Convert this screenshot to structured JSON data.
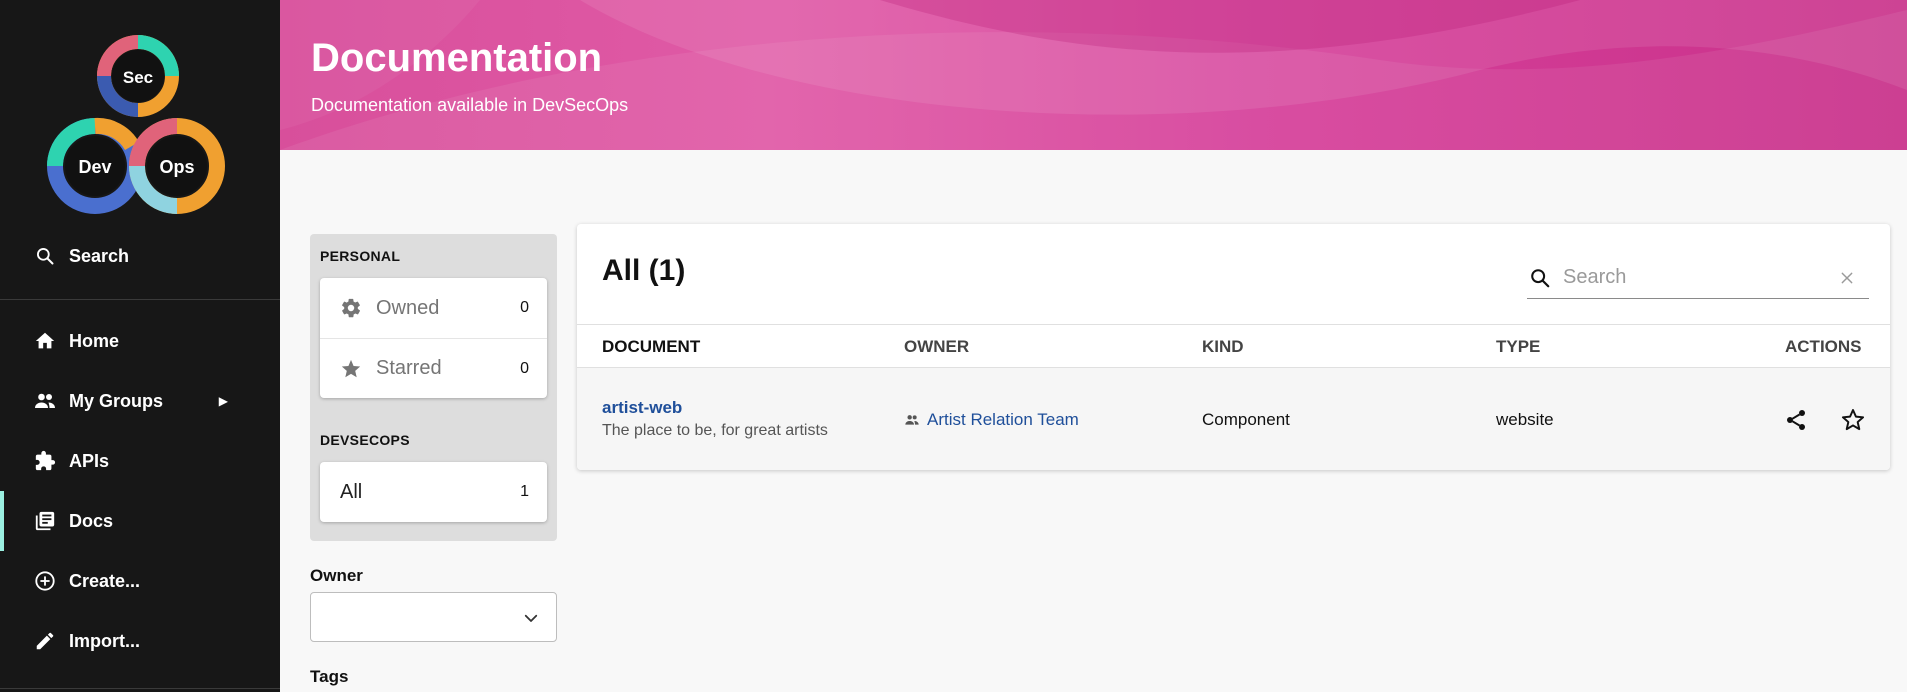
{
  "sidebar": {
    "search_label": "Search",
    "items": [
      {
        "label": "Home",
        "icon": "home-icon"
      },
      {
        "label": "My Groups",
        "icon": "groups-icon"
      },
      {
        "label": "APIs",
        "icon": "puzzle-icon"
      },
      {
        "label": "Docs",
        "icon": "docs-icon"
      },
      {
        "label": "Create...",
        "icon": "add-circle-icon"
      },
      {
        "label": "Import...",
        "icon": "pencil-icon"
      }
    ],
    "active_item": "Docs",
    "accent_color": "#9bf0e1"
  },
  "header": {
    "title": "Documentation",
    "subtitle": "Documentation available in DevSecOps"
  },
  "filters": {
    "personal_heading": "PERSONAL",
    "personal": [
      {
        "label": "Owned",
        "count": "0",
        "icon": "gear-icon"
      },
      {
        "label": "Starred",
        "count": "0",
        "icon": "star-icon"
      }
    ],
    "org_heading": "DEVSECOPS",
    "org": [
      {
        "label": "All",
        "count": "1"
      }
    ],
    "owner_label": "Owner",
    "owner_value": "",
    "tags_label": "Tags"
  },
  "table": {
    "title": "All (1)",
    "search_placeholder": "Search",
    "columns": [
      "DOCUMENT",
      "OWNER",
      "KIND",
      "TYPE",
      "ACTIONS"
    ],
    "rows": [
      {
        "document": "artist-web",
        "description": "The place to be, for great artists",
        "owner": "Artist Relation Team",
        "kind": "Component",
        "type": "website"
      }
    ]
  },
  "colors": {
    "header_pink": "#d6409a",
    "link_blue": "#1f4f9a",
    "sidebar_bg": "#171717"
  }
}
